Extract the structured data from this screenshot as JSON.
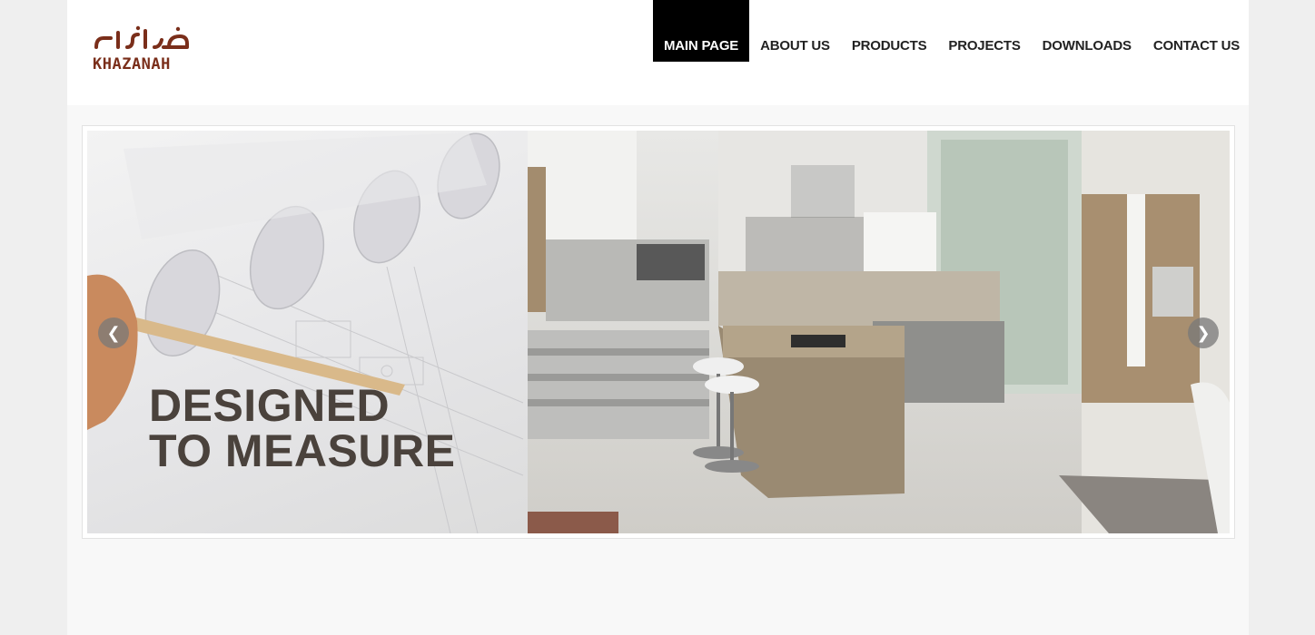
{
  "brand": {
    "name": "KHAZANAH",
    "arabic_name": "خزانة",
    "color": "#7a2e1a"
  },
  "nav": {
    "items": [
      {
        "label": "MAIN PAGE",
        "active": true
      },
      {
        "label": "ABOUT US",
        "active": false
      },
      {
        "label": "PRODUCTS",
        "active": false
      },
      {
        "label": "PROJECTS",
        "active": false
      },
      {
        "label": "DOWNLOADS",
        "active": false
      },
      {
        "label": "CONTACT US",
        "active": false
      }
    ]
  },
  "slider": {
    "headline_line1": "DESIGNED",
    "headline_line2": "TO MEASURE",
    "prev_icon": "chevron-left-icon",
    "next_icon": "chevron-right-icon"
  }
}
